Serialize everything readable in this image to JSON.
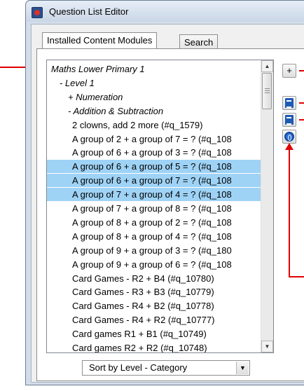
{
  "window": {
    "title": "Question List Editor"
  },
  "tabs": [
    {
      "label": "Installed Content Modules",
      "active": true
    },
    {
      "label": "Search",
      "active": false
    }
  ],
  "tree": {
    "rows": [
      {
        "label": "Maths Lower Primary 1",
        "italic": true,
        "selected": false
      },
      {
        "label": "- Level 1",
        "italic": true,
        "selected": false
      },
      {
        "label": "+ Numeration",
        "italic": true,
        "selected": false
      },
      {
        "label": "- Addition & Subtraction",
        "italic": true,
        "selected": false
      },
      {
        "label": "2 clowns, add 2 more (#q_1579)",
        "italic": false,
        "selected": false
      },
      {
        "label": "A group of 2 + a group of 7 = ? (#q_108",
        "italic": false,
        "selected": false
      },
      {
        "label": "A group of 6 + a group of 3 = ? (#q_108",
        "italic": false,
        "selected": false
      },
      {
        "label": "A group of 6 + a group of 5 = ? (#q_108",
        "italic": false,
        "selected": true
      },
      {
        "label": "A group of 6 + a group of 7 = ? (#q_108",
        "italic": false,
        "selected": true
      },
      {
        "label": "A group of 7 + a group of 4 = ? (#q_108",
        "italic": false,
        "selected": true
      },
      {
        "label": "A group of 7 + a group of 8 = ? (#q_108",
        "italic": false,
        "selected": false
      },
      {
        "label": "A group of 8 + a group of 2 = ? (#q_108",
        "italic": false,
        "selected": false
      },
      {
        "label": "A group of 8 + a group of 4 = ? (#q_108",
        "italic": false,
        "selected": false
      },
      {
        "label": "A group of 9 + a group of 3 = ? (#q_180",
        "italic": false,
        "selected": false
      },
      {
        "label": "A group of 9 + a group of 6 = ? (#q_108",
        "italic": false,
        "selected": false
      },
      {
        "label": "Card Games - R2 + B4 (#q_10780)",
        "italic": false,
        "selected": false
      },
      {
        "label": "Card Games - R3 + B3 (#q_10779)",
        "italic": false,
        "selected": false
      },
      {
        "label": "Card Games - R4 + B2 (#q_10778)",
        "italic": false,
        "selected": false
      },
      {
        "label": "Card Games - R4 + R2 (#q_10777)",
        "italic": false,
        "selected": false
      },
      {
        "label": "Card games R1 + B1 (#q_10749)",
        "italic": false,
        "selected": false
      },
      {
        "label": "Card games R2 + R2 (#q_10748)",
        "italic": false,
        "selected": false
      }
    ]
  },
  "buttons": {
    "add_label": "+",
    "copy_icon": "copy-document-icon",
    "paste_icon": "paste-document-icon",
    "remove_icon": "remove-ban-icon"
  },
  "sort": {
    "selected": "Sort by Level - Category"
  },
  "colors": {
    "selection": "#9fd3f6",
    "annotation": "#e00000"
  }
}
